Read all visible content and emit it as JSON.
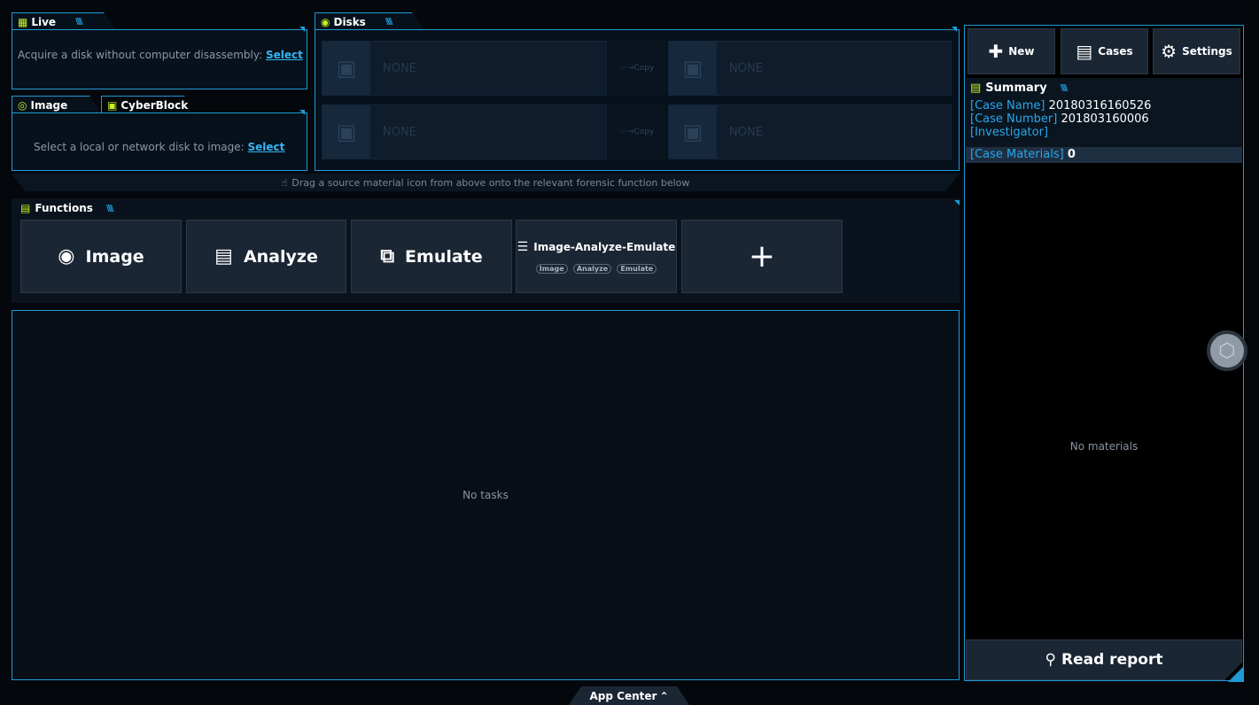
{
  "live": {
    "tab": "Live",
    "icon": "network-icon",
    "prompt": "Acquire a disk without computer disassembly:",
    "link": "Select"
  },
  "image_panel": {
    "tab_image": "Image",
    "tab_cyberblock": "CyberBlock",
    "prompt": "Select a local or network disk to image:",
    "link": "Select"
  },
  "disks": {
    "tab": "Disks",
    "slots": [
      {
        "label": "NONE"
      },
      {
        "label": "NONE"
      },
      {
        "label": "NONE"
      },
      {
        "label": "NONE"
      }
    ],
    "copy_label": "Copy",
    "hint": "Drag a source material icon from above onto the relevant forensic function below"
  },
  "functions": {
    "tab": "Functions",
    "buttons": {
      "image": "Image",
      "analyze": "Analyze",
      "emulate": "Emulate",
      "combo": "Image-Analyze-Emulate",
      "combo_chips": [
        "Image",
        "Analyze",
        "Emulate"
      ],
      "add": "+"
    }
  },
  "tasks": {
    "empty": "No tasks"
  },
  "sidebar": {
    "new": "New",
    "cases": "Cases",
    "settings": "Settings",
    "summary_title": "Summary",
    "case_name_key": "[Case Name]",
    "case_name_val": "20180316160526",
    "case_number_key": "[Case Number]",
    "case_number_val": "201803160006",
    "investigator_key": "[Investigator]",
    "materials_key": "[Case Materials]",
    "materials_val": "0",
    "no_materials": "No materials",
    "read_report": "Read report"
  },
  "footer": {
    "app_center": "App Center"
  },
  "colors": {
    "accent": "#1f9ad6",
    "highlight": "#c8ee24",
    "link": "#35b6f5"
  }
}
